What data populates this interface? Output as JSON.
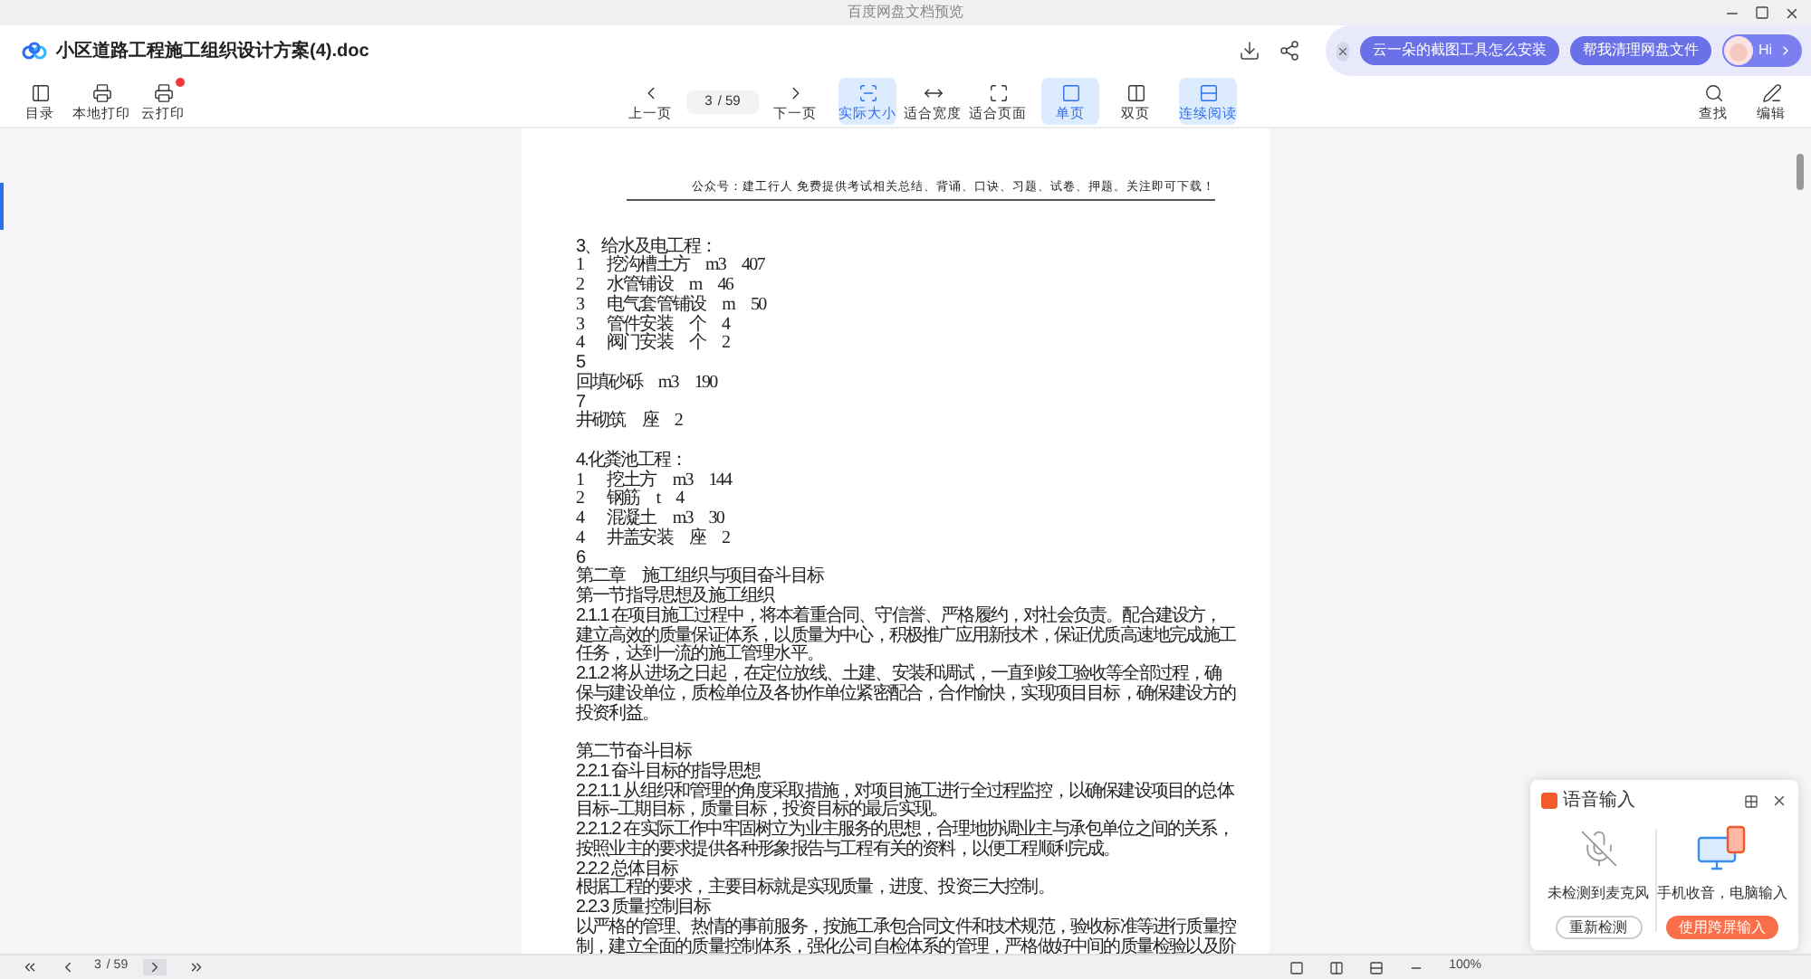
{
  "window": {
    "title": "百度网盘文档预览"
  },
  "header": {
    "filename": "小区道路工程施工组织设计方案(4).doc",
    "promo": {
      "buttons": [
        "云一朵的截图工具怎么安装",
        "帮我清理网盘文件"
      ],
      "greeting": "Hi"
    }
  },
  "toolbar": {
    "left": [
      {
        "kind": "toc",
        "label": "目录",
        "badge": false
      },
      {
        "kind": "print",
        "label": "本地打印",
        "badge": false
      },
      {
        "kind": "cloudprint",
        "label": "云打印",
        "badge": true
      }
    ],
    "prev": "上一页",
    "page": "3",
    "total": "/ 59",
    "next": "下一页",
    "views": [
      {
        "kind": "actual",
        "label": "实际大小",
        "selected": true
      },
      {
        "kind": "width",
        "label": "适合宽度",
        "selected": false
      },
      {
        "kind": "page",
        "label": "适合页面",
        "selected": false
      }
    ],
    "layouts": [
      {
        "kind": "single",
        "label": "单页",
        "selected": true
      },
      {
        "kind": "double",
        "label": "双页",
        "selected": false
      }
    ],
    "continuous": {
      "label": "连续阅读",
      "selected": true
    },
    "right": [
      {
        "kind": "search",
        "label": "查找"
      },
      {
        "kind": "edit",
        "label": "编辑"
      }
    ]
  },
  "document": {
    "header": "公众号：建工行人 免费提供考试相关总结、背诵、口诀、习题、试卷、押题。关注即可下载！",
    "lines": [
      {
        "kind": "gap"
      },
      {
        "kind": "para",
        "text": "3、给水及电工程："
      },
      {
        "kind": "row",
        "cells": [
          "1",
          "挖沟槽土方",
          "m3",
          "407"
        ]
      },
      {
        "kind": "row",
        "cells": [
          "2",
          "水管铺设",
          "m",
          "46"
        ]
      },
      {
        "kind": "row",
        "cells": [
          "3",
          "电气套管铺设",
          "m",
          "50"
        ]
      },
      {
        "kind": "row",
        "cells": [
          "3",
          "管件安装",
          "个",
          "4"
        ]
      },
      {
        "kind": "row",
        "cells": [
          "4",
          "阀门安装",
          "个",
          "2"
        ]
      },
      {
        "kind": "para",
        "text": "5"
      },
      {
        "kind": "row",
        "cells": [
          "回填砂砾",
          "m3",
          "190"
        ]
      },
      {
        "kind": "para",
        "text": "7"
      },
      {
        "kind": "row",
        "cells": [
          "井砌筑",
          "座",
          "2"
        ]
      },
      {
        "kind": "gap"
      },
      {
        "kind": "para",
        "text": "4.化粪池工程："
      },
      {
        "kind": "row",
        "cells": [
          "1",
          "挖土方",
          "m3",
          "144"
        ]
      },
      {
        "kind": "row",
        "cells": [
          "2",
          "钢筋",
          "t",
          "4"
        ]
      },
      {
        "kind": "row",
        "cells": [
          "4",
          "混凝土",
          "m3",
          "30"
        ]
      },
      {
        "kind": "row",
        "cells": [
          "4",
          "井盖安装",
          "座",
          "2"
        ]
      },
      {
        "kind": "para",
        "text": "6"
      },
      {
        "kind": "para",
        "text": "第二章　施工组织与项目奋斗目标"
      },
      {
        "kind": "para",
        "text": "第一节指导思想及施工组织"
      },
      {
        "kind": "para",
        "text": "2.1.1 在项目施工过程中，将本着重合同、守信誉、严格履约，对社会负责。配合建设方，"
      },
      {
        "kind": "para",
        "text": "建立高效的质量保证体系，以质量为中心，积极推广应用新技术，保证优质高速地完成施工"
      },
      {
        "kind": "para",
        "text": "任务，达到一流的施工管理水平。"
      },
      {
        "kind": "para",
        "text": "2.1.2 将从进场之日起，在定位放线、土建、安装和调试，一直到竣工验收等全部过程，确"
      },
      {
        "kind": "para",
        "text": "保与建设单位，质检单位及各协作单位紧密配合，合作愉快，实现项目目标，确保建设方的"
      },
      {
        "kind": "para",
        "text": "投资利益。"
      },
      {
        "kind": "gap"
      },
      {
        "kind": "para",
        "text": "第二节奋斗目标"
      },
      {
        "kind": "para",
        "text": "2.2.1 奋斗目标的指导思想"
      },
      {
        "kind": "para",
        "text": "2.2.1.1 从组织和管理的角度采取措施，对项目施工进行全过程监控，以确保建设项目的总体"
      },
      {
        "kind": "para",
        "text": "目标--工期目标，质量目标，投资目标的最后实现。"
      },
      {
        "kind": "para",
        "text": "2.2.1.2 在实际工作中牢固树立为业主服务的思想，合理地协调业主与承包单位之间的关系，"
      },
      {
        "kind": "para",
        "text": "按照业主的要求提供各种形象报告与工程有关的资料，以便工程顺利完成。"
      },
      {
        "kind": "para",
        "text": "2.2.2 总体目标"
      },
      {
        "kind": "para",
        "text": "根据工程的要求，主要目标就是实现质量，进度、投资三大控制。"
      },
      {
        "kind": "para",
        "text": "2.2.3 质量控制目标"
      },
      {
        "kind": "para",
        "text": "以严格的管理、热情的事前服务，按施工承包合同文件和技术规范，验收标准等进行质量控"
      },
      {
        "kind": "para",
        "text": "制，建立全面的质量控制体系，强化公司自检体系的管理，严格做好中间的质量检验以及阶"
      }
    ]
  },
  "bottom_bar": {
    "page": "3",
    "total": "/ 59",
    "zoom": "100%"
  },
  "voice_panel": {
    "title": "语音输入",
    "left": {
      "caption": "未检测到麦克风",
      "button": "重新检测"
    },
    "right": {
      "caption": "手机收音，电脑输入",
      "button": "使用跨屏输入"
    }
  }
}
